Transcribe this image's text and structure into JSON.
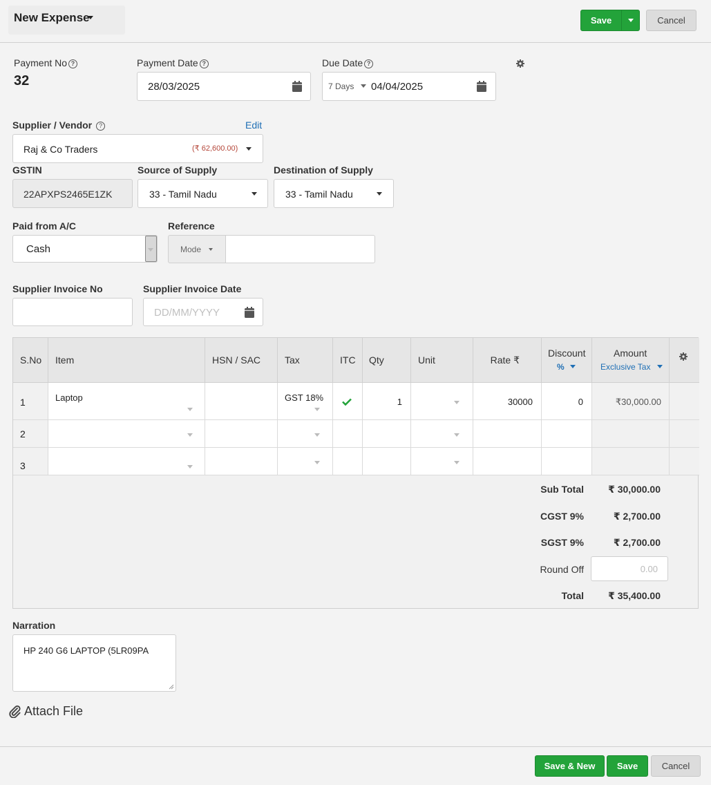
{
  "header": {
    "title": "New Expense",
    "save_label": "Save",
    "cancel_label": "Cancel"
  },
  "payment": {
    "no_label": "Payment No",
    "no_value": "32",
    "date_label": "Payment Date",
    "date_value": "28/03/2025",
    "due_label": "Due Date",
    "due_terms": "7 Days",
    "due_value": "04/04/2025"
  },
  "supplier": {
    "label": "Supplier / Vendor",
    "edit_label": "Edit",
    "name": "Raj & Co Traders",
    "balance": "(₹ 62,600.00)"
  },
  "gst": {
    "gstin_label": "GSTIN",
    "gstin_value": "22APXPS2465E1ZK",
    "source_label": "Source of Supply",
    "source_value": "33 - Tamil Nadu",
    "dest_label": "Destination of Supply",
    "dest_value": "33 - Tamil Nadu"
  },
  "paid": {
    "label": "Paid from A/C",
    "value": "Cash",
    "ref_label": "Reference",
    "mode_label": "Mode",
    "ref_value": ""
  },
  "invoice": {
    "no_label": "Supplier Invoice No",
    "no_value": "",
    "date_label": "Supplier Invoice Date",
    "date_placeholder": "DD/MM/YYYY"
  },
  "table": {
    "headers": {
      "sno": "S.No",
      "item": "Item",
      "hsn": "HSN / SAC",
      "tax": "Tax",
      "itc": "ITC",
      "qty": "Qty",
      "unit": "Unit",
      "rate": "Rate ₹",
      "discount": "Discount",
      "discount_sub": "%",
      "amount": "Amount",
      "amount_sub": "Exclusive Tax"
    },
    "rows": [
      {
        "sno": "1",
        "item": "Laptop",
        "hsn": "",
        "tax": "GST 18%",
        "itc": true,
        "qty": "1",
        "unit": "",
        "rate": "30000",
        "discount": "0",
        "amount": "₹30,000.00"
      },
      {
        "sno": "2",
        "item": "",
        "hsn": "",
        "tax": "",
        "itc": false,
        "qty": "",
        "unit": "",
        "rate": "",
        "discount": "",
        "amount": ""
      },
      {
        "sno": "3",
        "item": "",
        "hsn": "",
        "tax": "",
        "itc": false,
        "qty": "",
        "unit": "",
        "rate": "",
        "discount": "",
        "amount": ""
      }
    ]
  },
  "totals": {
    "subtotal_label": "Sub Total",
    "subtotal_value": "₹ 30,000.00",
    "cgst_label": "CGST 9%",
    "cgst_value": "₹ 2,700.00",
    "sgst_label": "SGST 9%",
    "sgst_value": "₹ 2,700.00",
    "roundoff_label": "Round Off",
    "roundoff_placeholder": "0.00",
    "total_label": "Total",
    "total_value": "₹ 35,400.00"
  },
  "narration": {
    "label": "Narration",
    "value": "HP 240 G6 LAPTOP (5LR09PA"
  },
  "attach": {
    "label": "Attach File"
  },
  "footer": {
    "save_new_label": "Save & New",
    "save_label": "Save",
    "cancel_label": "Cancel"
  },
  "colors": {
    "primary_green": "#23a33a",
    "link_blue": "#1f6fb5",
    "balance_red": "#b5473a"
  },
  "icons": [
    "caret-down-icon",
    "help-icon",
    "calendar-icon",
    "gear-icon",
    "check-icon",
    "paperclip-icon",
    "resize-handle-icon"
  ]
}
